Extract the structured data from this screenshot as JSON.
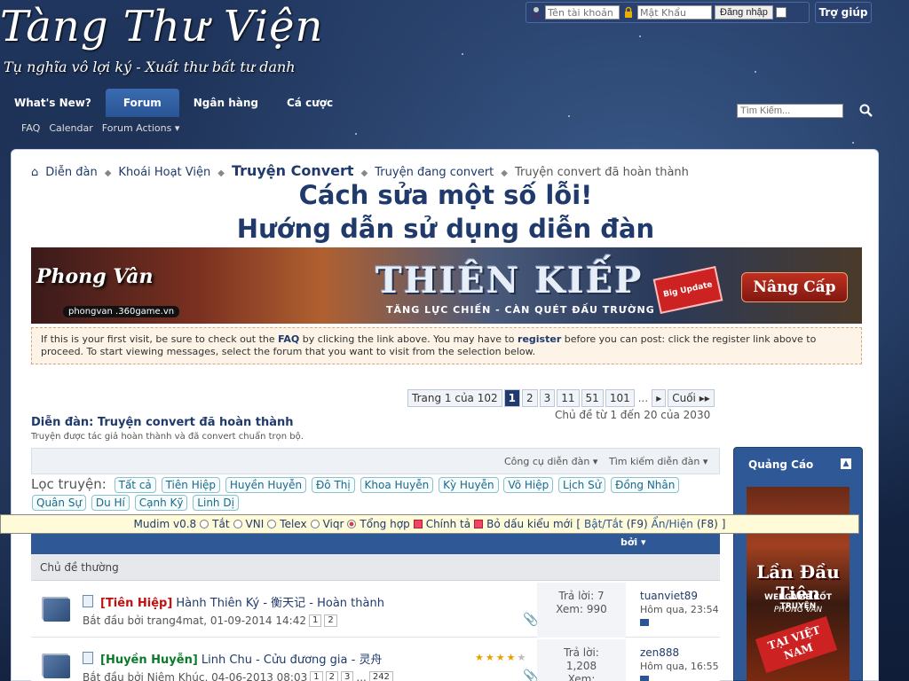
{
  "site": {
    "logo_title": "Tàng Thư Viện",
    "logo_subtitle": "Tụ nghĩa vô lợi ký - Xuất thư bất tư danh"
  },
  "login": {
    "username_placeholder": "Tên tài khoản",
    "password_placeholder": "Mật Khẩu",
    "login_label": "Đăng nhập",
    "help_label": "Trợ giúp"
  },
  "nav": {
    "tabs": [
      "What's New?",
      "Forum",
      "Ngân hàng",
      "Cá cược"
    ],
    "active": "Forum",
    "sub": [
      "FAQ",
      "Calendar",
      "Forum Actions ▾"
    ],
    "search_placeholder": "Tìm Kiếm..."
  },
  "breadcrumb": {
    "items": [
      "Diễn đàn",
      "Khoái Hoạt Viện",
      "Truyện Convert",
      "Truyện đang convert",
      "Truyện convert đã hoàn thành"
    ]
  },
  "headline": {
    "line1": "Cách sửa một số lỗi!",
    "line2": "Hướng dẫn sử dụng diễn đàn"
  },
  "banner": {
    "game": "Phong Vân",
    "url": "phongvan .360game.vn",
    "title": "THIÊN KIẾP",
    "tagline": "TĂNG LỰC CHIẾN - CÀN QUÉT ĐẤU TRƯỜNG",
    "badge": "Big Update",
    "button": "Nâng Cấp"
  },
  "notice": {
    "text_before_faq": "If this is your first visit, be sure to check out the ",
    "faq": "FAQ",
    "text_mid": " by clicking the link above. You may have to ",
    "register": "register",
    "text_after": " before you can post: click the register link above to proceed. To start viewing messages, select the forum that you want to visit from the selection below."
  },
  "pagination": {
    "label": "Trang 1 của 102",
    "pages": [
      "1",
      "2",
      "3",
      "11",
      "51",
      "101"
    ],
    "current": "1",
    "ellipsis": "...",
    "next": "▸",
    "last": "Cuối ▸▸",
    "summary": "Chủ đề từ 1 đến 20 của 2030"
  },
  "forum": {
    "title": "Diễn đàn: Truyện convert đã hoàn thành",
    "description": "Truyện được tác giả hoàn thành và đã convert chuẩn trọn bộ."
  },
  "toolbar": {
    "tools": "Công cụ diễn đàn ▾",
    "search": "Tìm kiếm diễn đàn ▾"
  },
  "filter": {
    "label": "Lọc truyện:",
    "chips": [
      "Tất cả",
      "Tiên Hiệp",
      "Huyền Huyễn",
      "Đô Thị",
      "Khoa Huyễn",
      "Kỳ Huyễn",
      "Võ Hiệp",
      "Lịch Sử",
      "Đồng Nhân",
      "Quân Sự",
      "Du Hí",
      "Cạnh Kỹ",
      "Linh Dị"
    ]
  },
  "mudim": {
    "name": "Mudim v0.8",
    "modes": [
      "Tắt",
      "VNI",
      "Telex",
      "Viqr",
      "Tổng hợp"
    ],
    "active_mode": "Tổng hợp",
    "checks": [
      "Chính tả",
      "Bỏ dấu kiểu mới"
    ],
    "toggle_link": "Bật/Tắt",
    "toggle_key": "(F9)",
    "hide_link": "Ẩn/Hiện",
    "hide_key": "(F8)",
    "open_bracket": "[",
    "close_bracket": "]"
  },
  "list": {
    "header_by": "bởi ▾",
    "section": "Chủ đề thường",
    "threads": [
      {
        "prefix": "[Tiên Hiệp]",
        "prefix_color": "#c01010",
        "title": "Hành Thiên Ký - 衡天记 - Hoàn thành",
        "meta": "Bắt đầu bởi trang4mat, 01-09-2014 14:42",
        "pages": [
          "1",
          "2"
        ],
        "replies": "Trả lời: 7",
        "views": "Xem: 990",
        "last_user": "tuanviet89",
        "last_time": "Hôm qua, 23:54",
        "rating": 0
      },
      {
        "prefix": "[Huyền Huyễn]",
        "prefix_color": "#0a7a2a",
        "title": "Linh Chu - Cửu đương gia - 灵舟",
        "meta": "Bắt đầu bởi Niệm Khúc, 04-06-2013 08:03",
        "pages": [
          "1",
          "2",
          "3",
          "...",
          "242"
        ],
        "replies": "Trả lời:",
        "replies_count": "1,208",
        "views": "Xem:",
        "last_user": "zen888",
        "last_time": "Hôm qua, 16:55",
        "rating": 4
      }
    ]
  },
  "sidebar": {
    "title": "Quảng Cáo",
    "ad_big": "Lần Đầu Tiên",
    "ad_line1": "WEBGAME CỐT TRUYỆN",
    "ad_line2": "PHONG VÂN",
    "ad_badge": "TẠI VIỆT NAM"
  }
}
